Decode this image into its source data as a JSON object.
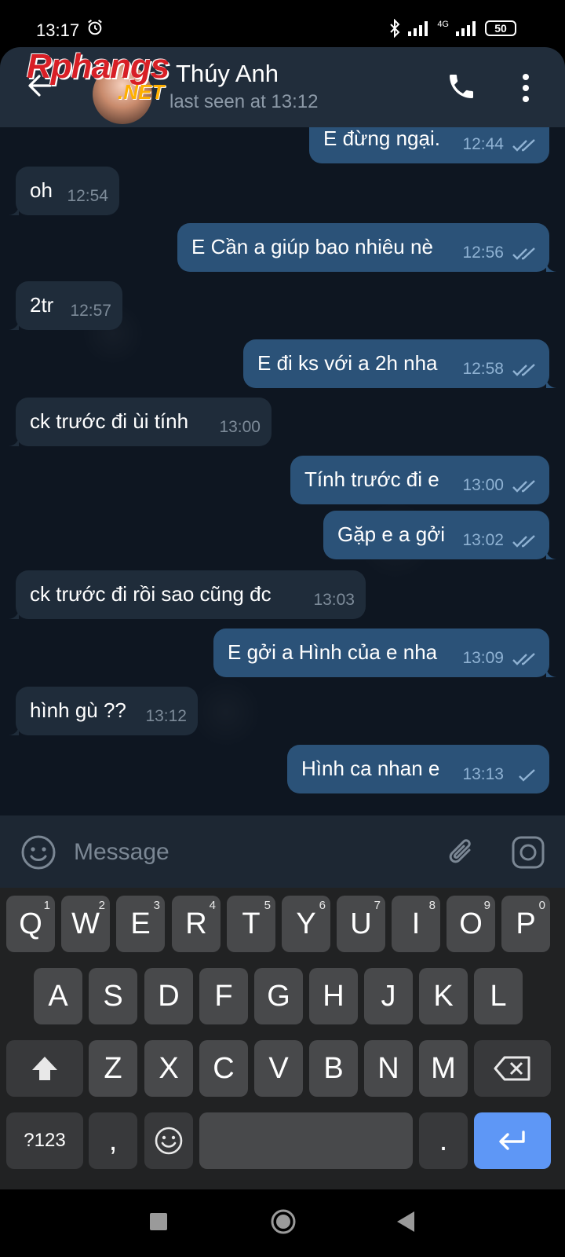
{
  "status_bar": {
    "time": "13:17",
    "network": "4G",
    "battery": "50"
  },
  "header": {
    "contact_name": "Thúy Anh",
    "last_seen": "last seen at 13:12",
    "watermark": "Rphangs",
    "watermark_net": ".NET"
  },
  "messages": [
    {
      "dir": "out",
      "text": "E đừng ngại.",
      "time": "12:44",
      "read": true
    },
    {
      "dir": "in",
      "text": "oh",
      "time": "12:54"
    },
    {
      "dir": "out",
      "text": "E Cần a giúp bao nhiêu nè",
      "time": "12:56",
      "read": true
    },
    {
      "dir": "in",
      "text": "2tr",
      "time": "12:57"
    },
    {
      "dir": "out",
      "text": "E đi ks với a 2h nha",
      "time": "12:58",
      "read": true
    },
    {
      "dir": "in",
      "text": "ck trước đi ùi tính",
      "time": "13:00"
    },
    {
      "dir": "out",
      "text": "Tính trước đi e",
      "time": "13:00",
      "read": true
    },
    {
      "dir": "out",
      "text": "Gặp e a gởi",
      "time": "13:02",
      "read": true
    },
    {
      "dir": "in",
      "text": "ck trước đi rồi sao cũng đc",
      "time": "13:03"
    },
    {
      "dir": "out",
      "text": "E gởi a Hình của e nha",
      "time": "13:09",
      "read": true
    },
    {
      "dir": "in",
      "text": "hình gù ??",
      "time": "13:12"
    },
    {
      "dir": "out",
      "text": "Hình ca nhan e",
      "time": "13:13",
      "read": false
    }
  ],
  "composer": {
    "placeholder": "Message"
  },
  "keyboard": {
    "row1": [
      [
        "Q",
        "1"
      ],
      [
        "W",
        "2"
      ],
      [
        "E",
        "3"
      ],
      [
        "R",
        "4"
      ],
      [
        "T",
        "5"
      ],
      [
        "Y",
        "6"
      ],
      [
        "U",
        "7"
      ],
      [
        "I",
        "8"
      ],
      [
        "O",
        "9"
      ],
      [
        "P",
        "0"
      ]
    ],
    "row2": [
      "A",
      "S",
      "D",
      "F",
      "G",
      "H",
      "J",
      "K",
      "L"
    ],
    "row3": [
      "Z",
      "X",
      "C",
      "V",
      "B",
      "N",
      "M"
    ],
    "symbols_label": "?123",
    "comma": ",",
    "period": "."
  },
  "colors": {
    "chat_bg": "#0e1621",
    "outgoing": "#2b5278",
    "incoming": "#1f2c3a",
    "enter_key": "#5e97f6"
  }
}
